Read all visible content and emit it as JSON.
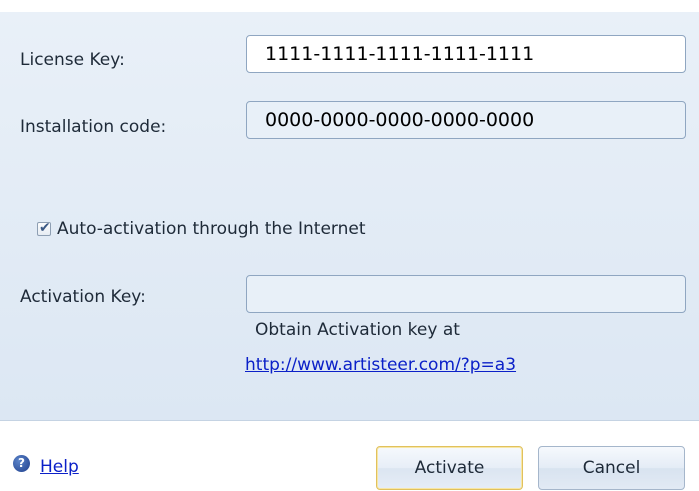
{
  "form": {
    "license_key_label": "License Key:",
    "license_key_value": "1111-1111-1111-1111-1111",
    "installation_code_label": "Installation code:",
    "installation_code_value": "0000-0000-0000-0000-0000",
    "auto_activation_label": "Auto-activation through the Internet",
    "auto_activation_checked": true,
    "activation_key_label": "Activation Key:",
    "activation_key_value": "",
    "obtain_text": "Obtain Activation key at",
    "obtain_link": "http://www.artisteer.com/?p=a3"
  },
  "footer": {
    "help_icon": "help-icon",
    "help_label": "Help",
    "activate_label": "Activate",
    "cancel_label": "Cancel"
  },
  "colors": {
    "panel_background": "#dfe9f4",
    "field_border": "#8fa6c1",
    "link": "#0b20c8",
    "default_button_border": "#e1c15d"
  }
}
